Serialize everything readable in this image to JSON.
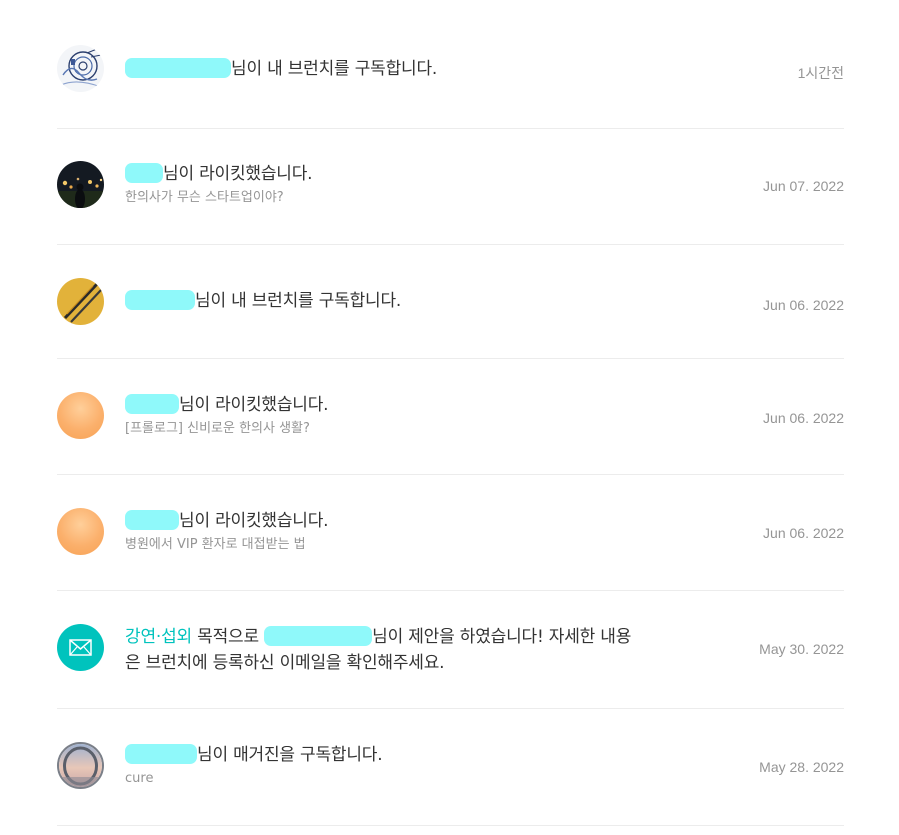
{
  "items": [
    {
      "kind": "subscribe",
      "avatar_icon": "ink-drawing-avatar",
      "message": "님이 내 브런치를 구독합니다.",
      "time": "1시간전"
    },
    {
      "kind": "like",
      "avatar_icon": "night-city-photo-avatar",
      "message": "님이 라이킷했습니다.",
      "sub": "한의사가 무슨 스타트업이야?",
      "time": "Jun 07. 2022"
    },
    {
      "kind": "subscribe",
      "avatar_icon": "pencils-photo-avatar",
      "message": "님이 내 브런치를 구독합니다.",
      "time": "Jun 06. 2022"
    },
    {
      "kind": "like",
      "avatar_icon": "default-orange-avatar",
      "message": "님이 라이킷했습니다.",
      "sub": "[프롤로그] 신비로운 한의사 생활?",
      "time": "Jun 06. 2022"
    },
    {
      "kind": "like",
      "avatar_icon": "default-orange-avatar",
      "message": "님이 라이킷했습니다.",
      "sub": "병원에서 VIP 환자로 대접받는 법",
      "time": "Jun 06. 2022"
    },
    {
      "kind": "proposal",
      "avatar_icon": "envelope-icon",
      "purpose": "강연·섭외",
      "prefix": " 목적으로 ",
      "message": "님이 제안을 하였습니다! 자세한 내용은 브런치에 등록하신 이메일을 확인해주세요.",
      "time": "May 30. 2022"
    },
    {
      "kind": "magazine",
      "avatar_icon": "sky-photo-avatar",
      "message": "님이 매거진을 구독합니다.",
      "sub": "cure",
      "time": "May 28. 2022"
    }
  ],
  "colors": {
    "accent": "#00c3bd",
    "redaction": "#8ff9fa",
    "muted": "#959595",
    "text": "#333333",
    "divider": "#ececec"
  }
}
